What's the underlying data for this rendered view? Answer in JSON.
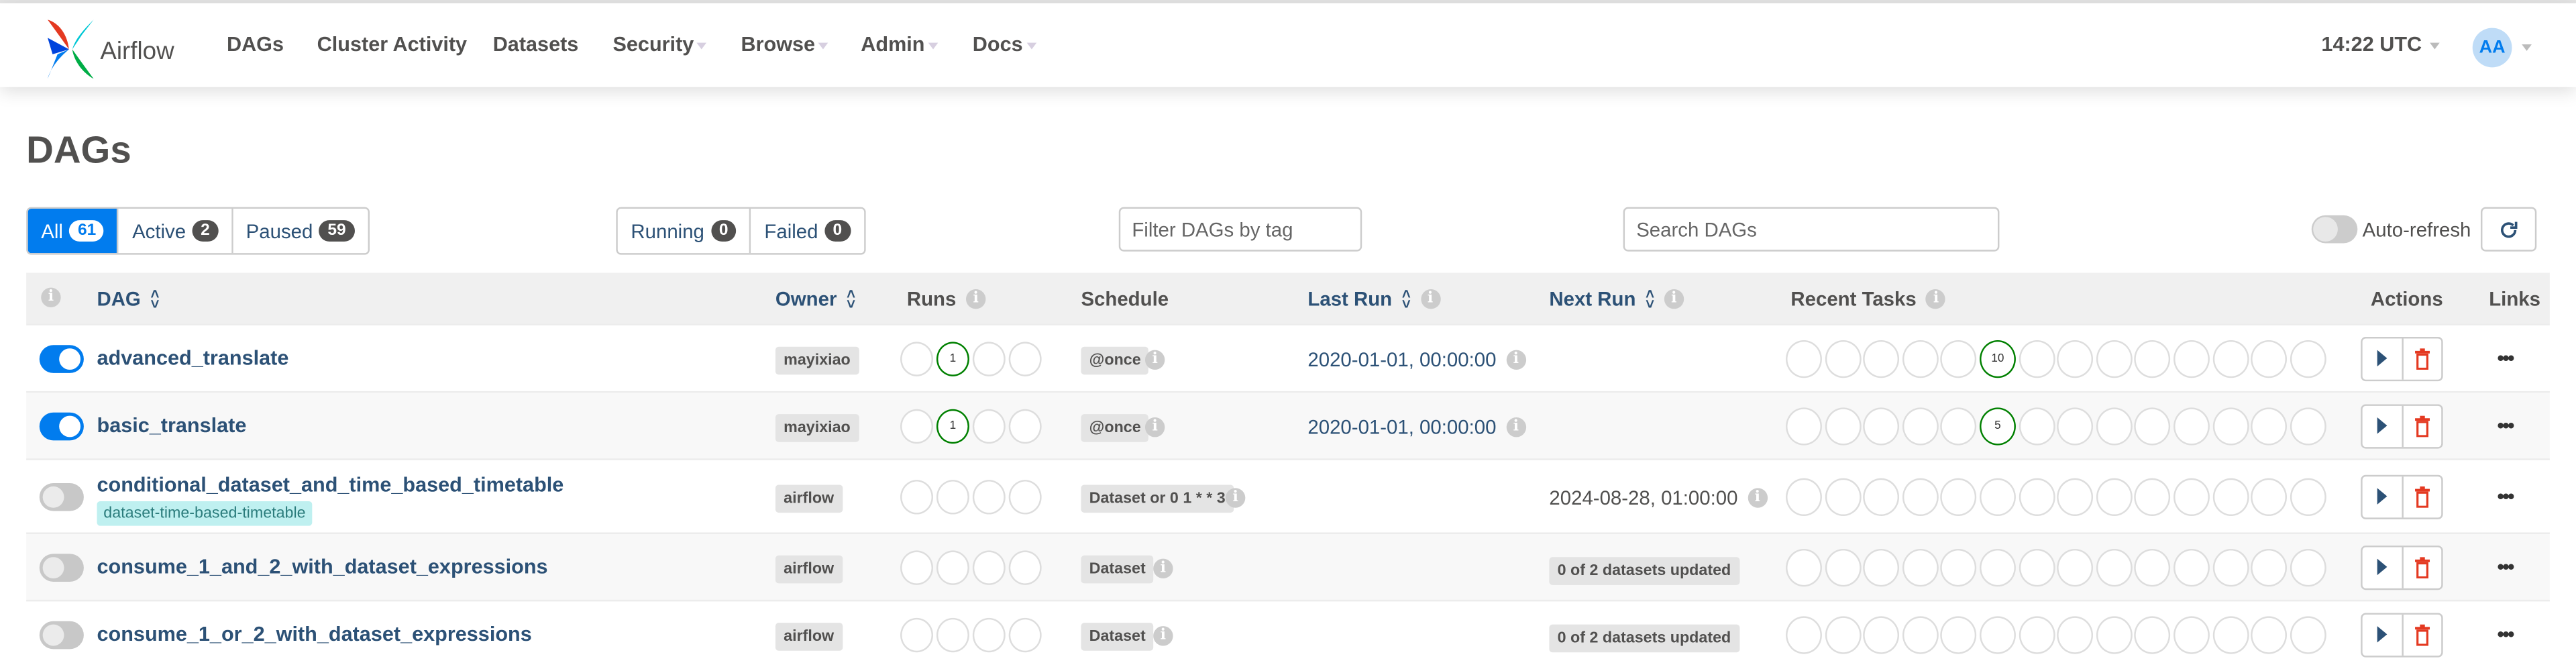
{
  "navbar": {
    "brand": "Airflow",
    "items": [
      {
        "label": "DAGs",
        "dropdown": false
      },
      {
        "label": "Cluster Activity",
        "dropdown": false
      },
      {
        "label": "Datasets",
        "dropdown": false
      },
      {
        "label": "Security",
        "dropdown": true
      },
      {
        "label": "Browse",
        "dropdown": true
      },
      {
        "label": "Admin",
        "dropdown": true
      },
      {
        "label": "Docs",
        "dropdown": true
      }
    ],
    "clock": "14:22 UTC",
    "avatar": "AA"
  },
  "page_title": "DAGs",
  "status_filters": [
    {
      "label": "All",
      "count": "61",
      "active": true
    },
    {
      "label": "Active",
      "count": "2",
      "active": false
    },
    {
      "label": "Paused",
      "count": "59",
      "active": false
    }
  ],
  "run_filters": [
    {
      "label": "Running",
      "count": "0"
    },
    {
      "label": "Failed",
      "count": "0"
    }
  ],
  "tag_filter": {
    "placeholder": "Filter DAGs by tag",
    "value": ""
  },
  "search": {
    "placeholder": "Search DAGs",
    "value": ""
  },
  "auto_refresh": {
    "label": "Auto-refresh",
    "enabled": false
  },
  "table": {
    "headers": {
      "dag": "DAG",
      "owner": "Owner",
      "runs": "Runs",
      "schedule": "Schedule",
      "last_run": "Last Run",
      "next_run": "Next Run",
      "recent_tasks": "Recent Tasks",
      "actions": "Actions",
      "links": "Links"
    },
    "links_label": "•••",
    "rows": [
      {
        "name": "advanced_translate",
        "active": true,
        "tag": null,
        "owner": "mayixiao",
        "runs": [
          "",
          "1",
          "",
          ""
        ],
        "schedule": "@once",
        "last_run": "2020-01-01, 00:00:00",
        "next_run": null,
        "next_run_label": null,
        "recent_tasks": [
          "",
          "",
          "",
          "",
          "",
          "10",
          "",
          "",
          "",
          "",
          "",
          "",
          "",
          ""
        ]
      },
      {
        "name": "basic_translate",
        "active": true,
        "tag": null,
        "owner": "mayixiao",
        "runs": [
          "",
          "1",
          "",
          ""
        ],
        "schedule": "@once",
        "last_run": "2020-01-01, 00:00:00",
        "next_run": null,
        "next_run_label": null,
        "recent_tasks": [
          "",
          "",
          "",
          "",
          "",
          "5",
          "",
          "",
          "",
          "",
          "",
          "",
          "",
          ""
        ]
      },
      {
        "name": "conditional_dataset_and_time_based_timetable",
        "active": false,
        "tag": "dataset-time-based-timetable",
        "owner": "airflow",
        "runs": [
          "",
          "",
          "",
          ""
        ],
        "schedule": "Dataset or 0 1 * * 3",
        "last_run": null,
        "next_run": "2024-08-28, 01:00:00",
        "next_run_label": null,
        "recent_tasks": [
          "",
          "",
          "",
          "",
          "",
          "",
          "",
          "",
          "",
          "",
          "",
          "",
          "",
          ""
        ]
      },
      {
        "name": "consume_1_and_2_with_dataset_expressions",
        "active": false,
        "tag": null,
        "owner": "airflow",
        "runs": [
          "",
          "",
          "",
          ""
        ],
        "schedule": "Dataset",
        "last_run": null,
        "next_run": null,
        "next_run_label": "0 of 2 datasets updated",
        "recent_tasks": [
          "",
          "",
          "",
          "",
          "",
          "",
          "",
          "",
          "",
          "",
          "",
          "",
          "",
          ""
        ]
      },
      {
        "name": "consume_1_or_2_with_dataset_expressions",
        "active": false,
        "tag": null,
        "owner": "airflow",
        "runs": [
          "",
          "",
          "",
          ""
        ],
        "schedule": "Dataset",
        "last_run": null,
        "next_run": null,
        "next_run_label": "0 of 2 datasets updated",
        "recent_tasks": [
          "",
          "",
          "",
          "",
          "",
          "",
          "",
          "",
          "",
          "",
          "",
          "",
          "",
          ""
        ]
      }
    ]
  },
  "colors": {
    "primary": "#017cee",
    "link": "#2c5176",
    "success": "#008000",
    "delete": "#e43921"
  }
}
